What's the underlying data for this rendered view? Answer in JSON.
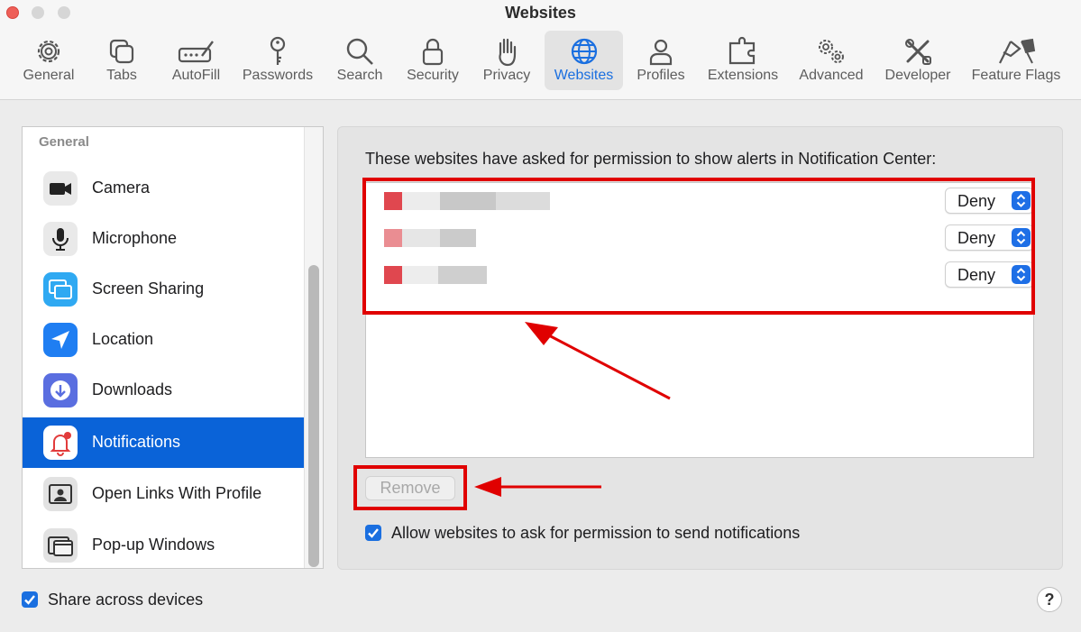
{
  "window": {
    "title": "Websites"
  },
  "toolbar": {
    "items": [
      {
        "label": "General",
        "icon": "gear-icon"
      },
      {
        "label": "Tabs",
        "icon": "tabs-icon"
      },
      {
        "label": "AutoFill",
        "icon": "autofill-icon"
      },
      {
        "label": "Passwords",
        "icon": "key-icon"
      },
      {
        "label": "Search",
        "icon": "search-icon"
      },
      {
        "label": "Security",
        "icon": "lock-icon"
      },
      {
        "label": "Privacy",
        "icon": "hand-icon"
      },
      {
        "label": "Websites",
        "icon": "globe-icon",
        "selected": true
      },
      {
        "label": "Profiles",
        "icon": "person-icon"
      },
      {
        "label": "Extensions",
        "icon": "puzzle-icon"
      },
      {
        "label": "Advanced",
        "icon": "gears-icon"
      },
      {
        "label": "Developer",
        "icon": "tools-icon"
      },
      {
        "label": "Feature Flags",
        "icon": "flags-icon"
      }
    ],
    "active_color": "#1a6fe0"
  },
  "sidebar": {
    "section_label": "General",
    "items": [
      {
        "label": "Camera",
        "icon": "camera-icon"
      },
      {
        "label": "Microphone",
        "icon": "microphone-icon"
      },
      {
        "label": "Screen Sharing",
        "icon": "screen-sharing-icon"
      },
      {
        "label": "Location",
        "icon": "location-icon"
      },
      {
        "label": "Downloads",
        "icon": "downloads-icon"
      },
      {
        "label": "Notifications",
        "icon": "notifications-icon",
        "selected": true
      },
      {
        "label": "Open Links With Profile",
        "icon": "profile-links-icon"
      },
      {
        "label": "Pop-up Windows",
        "icon": "popup-windows-icon"
      }
    ],
    "selected_color": "#0a63d8"
  },
  "main": {
    "heading": "These websites have asked for permission to show alerts in Notification Center:",
    "sites": [
      {
        "permission": "Deny"
      },
      {
        "permission": "Deny"
      },
      {
        "permission": "Deny"
      }
    ],
    "remove_label": "Remove",
    "allow_label": "Allow websites to ask for permission to send notifications",
    "allow_checked": true
  },
  "footer": {
    "share_label": "Share across devices",
    "share_checked": true,
    "help_label": "?"
  },
  "annotation_color": "#e00000"
}
